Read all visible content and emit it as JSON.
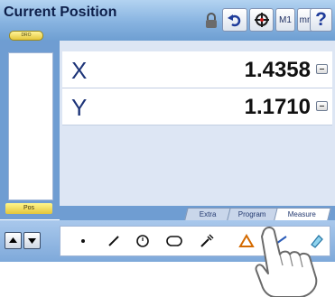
{
  "header": {
    "title": "Current Position",
    "mode_tag": "DRO",
    "buttons": {
      "m1_label": "M1",
      "units_label": "mm",
      "help_label": "?"
    }
  },
  "readouts": [
    {
      "axis": "X",
      "value": "1.4358"
    },
    {
      "axis": "Y",
      "value": "1.1710"
    }
  ],
  "left_panel": {
    "pos_label": "Pos"
  },
  "tabs": [
    {
      "label": "Extra"
    },
    {
      "label": "Program"
    },
    {
      "label": "Measure",
      "active": true
    }
  ],
  "measure_tools": [
    "point-icon",
    "line-icon",
    "circle-icon",
    "slot-icon",
    "probe-icon",
    "angle-icon",
    "distance-icon",
    "erase-icon"
  ],
  "colors": {
    "bar_blue": "#87b3e0",
    "panel_blue": "#6f9dd2",
    "tag_yellow": "#f2da55"
  }
}
